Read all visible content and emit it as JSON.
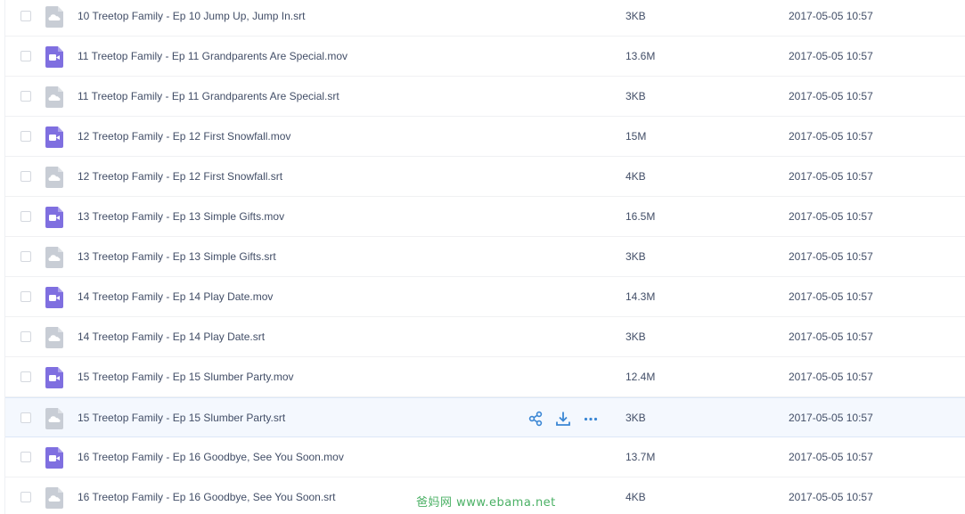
{
  "files": [
    {
      "name": "10 Treetop Family - Ep 10 Jump Up, Jump In.srt",
      "type": "srt",
      "size": "3KB",
      "date": "2017-05-05 10:57"
    },
    {
      "name": "11 Treetop Family - Ep 11 Grandparents Are Special.mov",
      "type": "mov",
      "size": "13.6M",
      "date": "2017-05-05 10:57"
    },
    {
      "name": "11 Treetop Family - Ep 11 Grandparents Are Special.srt",
      "type": "srt",
      "size": "3KB",
      "date": "2017-05-05 10:57"
    },
    {
      "name": "12 Treetop Family - Ep 12 First Snowfall.mov",
      "type": "mov",
      "size": "15M",
      "date": "2017-05-05 10:57"
    },
    {
      "name": "12 Treetop Family - Ep 12 First Snowfall.srt",
      "type": "srt",
      "size": "4KB",
      "date": "2017-05-05 10:57"
    },
    {
      "name": "13 Treetop Family - Ep 13 Simple Gifts.mov",
      "type": "mov",
      "size": "16.5M",
      "date": "2017-05-05 10:57"
    },
    {
      "name": "13 Treetop Family - Ep 13 Simple Gifts.srt",
      "type": "srt",
      "size": "3KB",
      "date": "2017-05-05 10:57"
    },
    {
      "name": "14 Treetop Family - Ep 14 Play Date.mov",
      "type": "mov",
      "size": "14.3M",
      "date": "2017-05-05 10:57"
    },
    {
      "name": "14 Treetop Family - Ep 14 Play Date.srt",
      "type": "srt",
      "size": "3KB",
      "date": "2017-05-05 10:57"
    },
    {
      "name": "15 Treetop Family - Ep 15 Slumber Party.mov",
      "type": "mov",
      "size": "12.4M",
      "date": "2017-05-05 10:57"
    },
    {
      "name": "15 Treetop Family - Ep 15 Slumber Party.srt",
      "type": "srt",
      "size": "3KB",
      "date": "2017-05-05 10:57",
      "hovered": true
    },
    {
      "name": "16 Treetop Family - Ep 16 Goodbye, See You Soon.mov",
      "type": "mov",
      "size": "13.7M",
      "date": "2017-05-05 10:57"
    },
    {
      "name": "16 Treetop Family - Ep 16 Goodbye, See You Soon.srt",
      "type": "srt",
      "size": "4KB",
      "date": "2017-05-05 10:57"
    }
  ],
  "row_actions": {
    "share_icon": "share-icon",
    "download_icon": "download-icon",
    "more_icon": "more-icon"
  },
  "icons": {
    "mov": "video-file-icon",
    "srt": "cloud-file-icon"
  },
  "colors": {
    "video_icon": "#7f6fe0",
    "cloud_file_icon": "#c8cdd5",
    "action_blue": "#3a86d4",
    "hover_row": "#f4f8fe",
    "text": "#424e67",
    "watermark": "#4ab064"
  },
  "watermark": {
    "text": "爸妈网 www.ebama.net"
  }
}
